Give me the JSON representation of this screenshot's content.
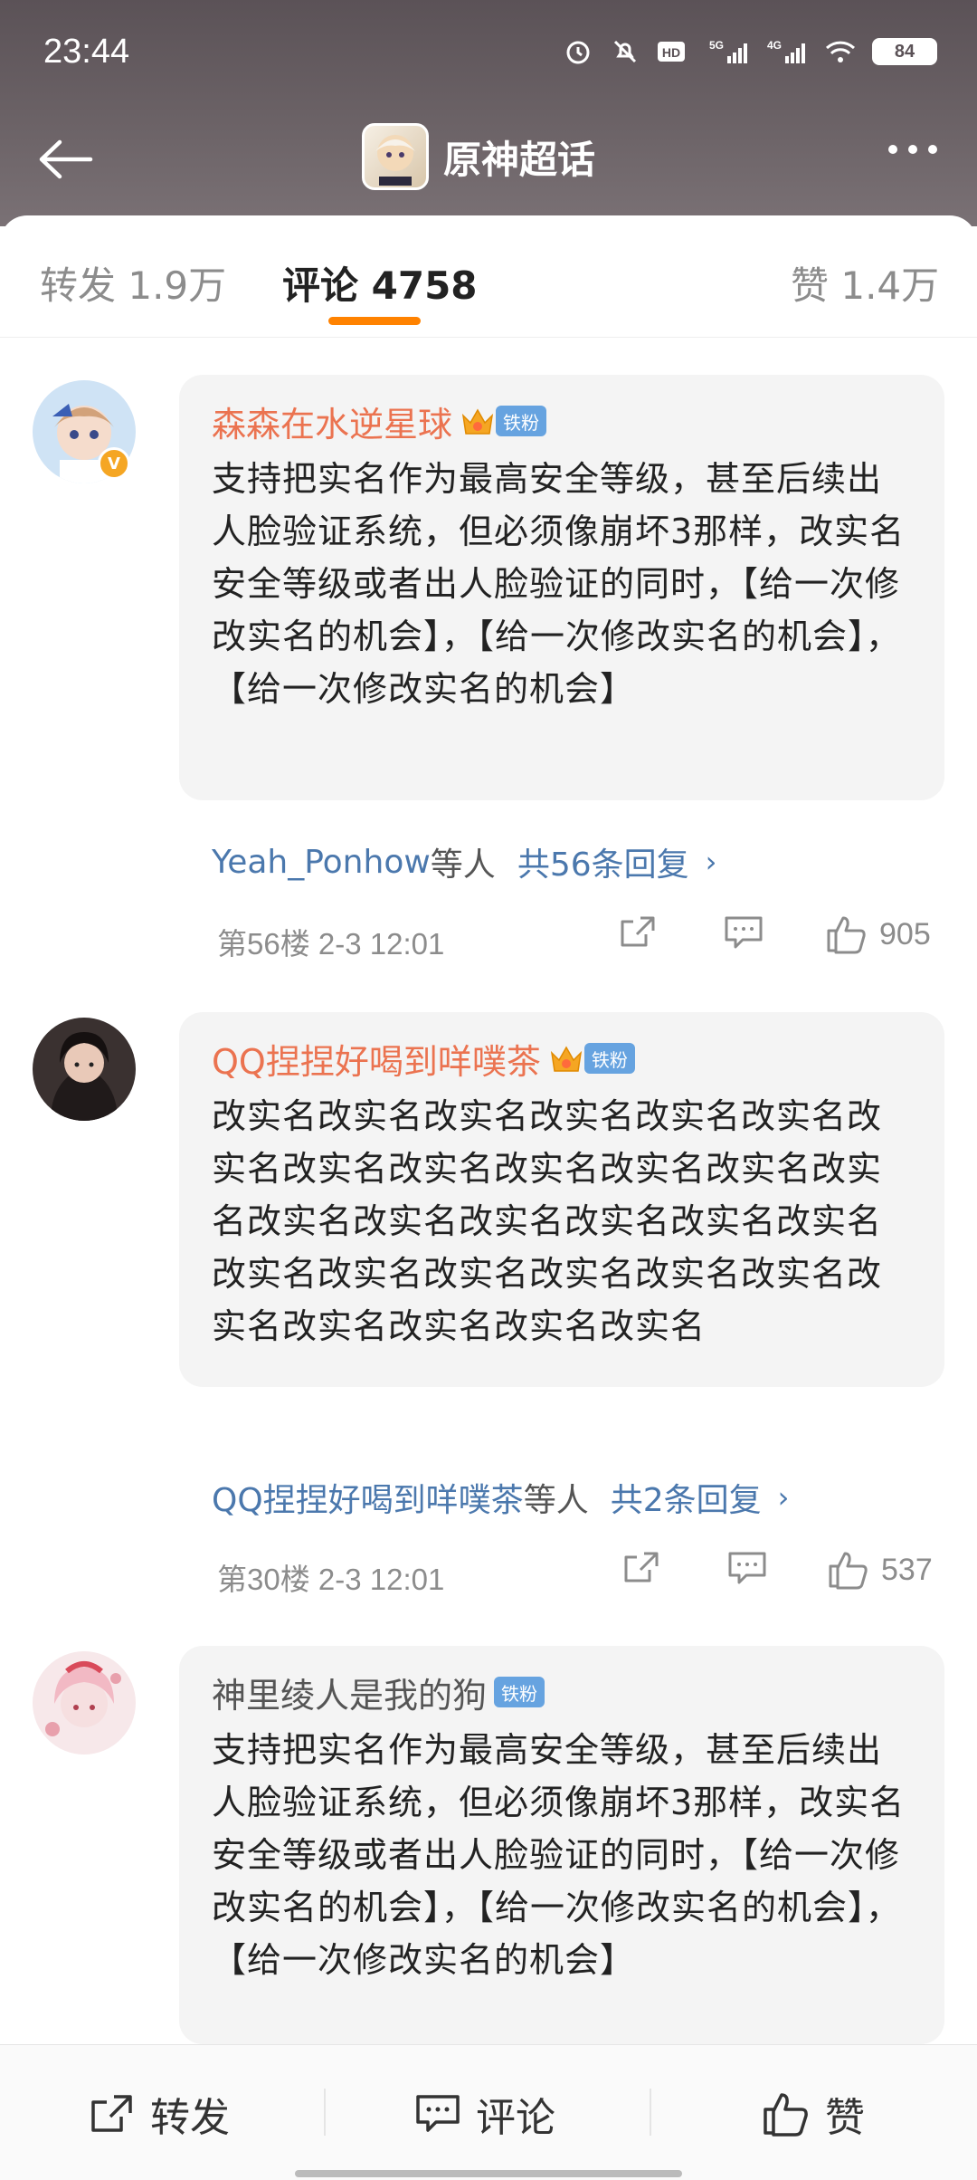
{
  "status": {
    "time": "23:44",
    "battery": "84",
    "network_a": "5G",
    "network_b": "4G",
    "hd": "HD"
  },
  "nav": {
    "title": "原神超话"
  },
  "tabs": {
    "repost": "转发 1.9万",
    "comments": "评论 4758",
    "likes": "赞 1.4万"
  },
  "comments": [
    {
      "username": "森森在水逆星球",
      "badge": "铁粉",
      "text": "支持把实名作为最高安全等级，甚至后续出人脸验证系统，但必须像崩坏3那样，改实名安全等级或者出人脸验证的同时，【给一次修改实名的机会】，【给一次修改实名的机会】，【给一次修改实名的机会】",
      "reply_users": "Yeah_Ponhow",
      "reply_etc": "等人",
      "reply_count": "共56条回复",
      "floor": "第56楼  2-3 12:01",
      "likes": "905"
    },
    {
      "username": "QQ捏捏好喝到咩噗茶",
      "badge": "铁粉",
      "text": "改实名改实名改实名改实名改实名改实名改实名改实名改实名改实名改实名改实名改实名改实名改实名改实名改实名改实名改实名改实名改实名改实名改实名改实名改实名改实名改实名改实名改实名改实名",
      "reply_users": "QQ捏捏好喝到咩噗茶",
      "reply_etc": "等人",
      "reply_count": "共2条回复",
      "floor": "第30楼  2-3 12:01",
      "likes": "537"
    },
    {
      "username": "神里绫人是我的狗",
      "badge": "铁粉",
      "text": "支持把实名作为最高安全等级，甚至后续出人脸验证系统，但必须像崩坏3那样，改实名安全等级或者出人脸验证的同时，【给一次修改实名的机会】，【给一次修改实名的机会】，【给一次修改实名的机会】"
    }
  ],
  "bottom": {
    "repost": "转发",
    "comment": "评论",
    "like": "赞"
  },
  "colors": {
    "accent": "#ff8200",
    "username": "#eb7350",
    "link": "#4b78ad",
    "fan_tag": "#66a3e0"
  }
}
